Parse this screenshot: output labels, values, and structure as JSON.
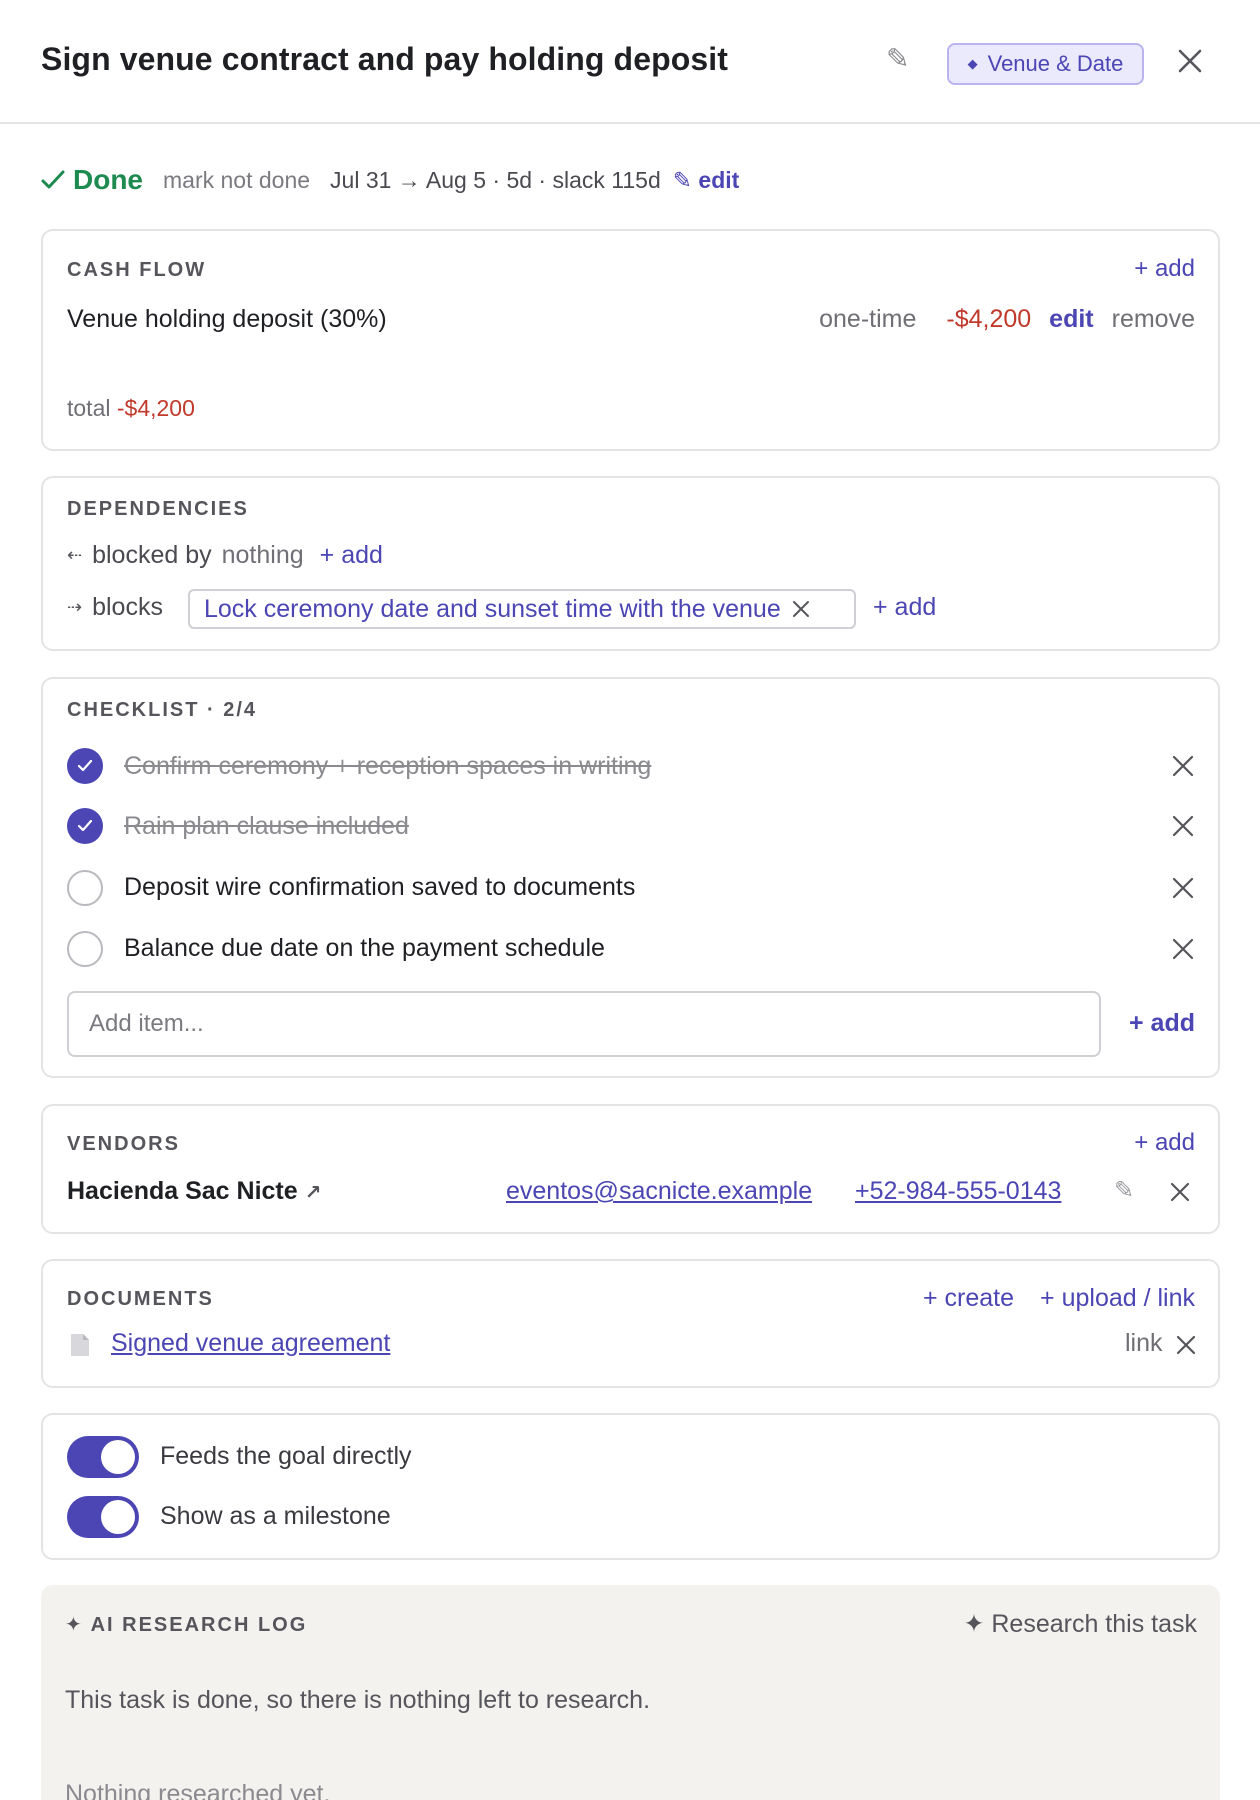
{
  "header": {
    "title": "Sign venue contract and pay holding deposit",
    "tag": "Venue & Date"
  },
  "status": {
    "done_label": "Done",
    "mark_not_done": "mark not done",
    "dates": "Jul 31 → Aug 5 · 5d · slack 115d",
    "edit": "edit"
  },
  "cash_flow": {
    "label": "CASH FLOW",
    "add": "+ add",
    "item": {
      "name": "Venue holding deposit (30%)",
      "frequency": "one-time",
      "amount": "-$4,200",
      "edit": "edit",
      "remove": "remove"
    },
    "total_label": "total",
    "total_value": "-$4,200"
  },
  "dependencies": {
    "label": "DEPENDENCIES",
    "blocked_by_label": "blocked by",
    "blocked_by_value": "nothing",
    "blocks_label": "blocks",
    "blocks_item": "Lock ceremony date and sunset time with the venue",
    "add": "+ add"
  },
  "checklist": {
    "label": "CHECKLIST · 2/4",
    "items": [
      {
        "text": "Confirm ceremony + reception spaces in writing",
        "done": true
      },
      {
        "text": "Rain plan clause included",
        "done": true
      },
      {
        "text": "Deposit wire confirmation saved to documents",
        "done": false
      },
      {
        "text": "Balance due date on the payment schedule",
        "done": false
      }
    ],
    "placeholder": "Add item...",
    "add": "+ add"
  },
  "vendors": {
    "label": "VENDORS",
    "add": "+ add",
    "name": "Hacienda Sac Nicte",
    "email": "eventos@sacnicte.example",
    "phone": "+52-984-555-0143"
  },
  "documents": {
    "label": "DOCUMENTS",
    "create": "+ create",
    "upload": "+ upload / link",
    "doc_name": "Signed venue agreement",
    "doc_type": "link"
  },
  "toggles": {
    "feeds_goal": "Feeds the goal directly",
    "milestone": "Show as a milestone"
  },
  "ai_log": {
    "label": "AI RESEARCH LOG",
    "research_button": "Research this task",
    "message": "This task is done, so there is nothing left to research.",
    "empty": "Nothing researched yet."
  }
}
